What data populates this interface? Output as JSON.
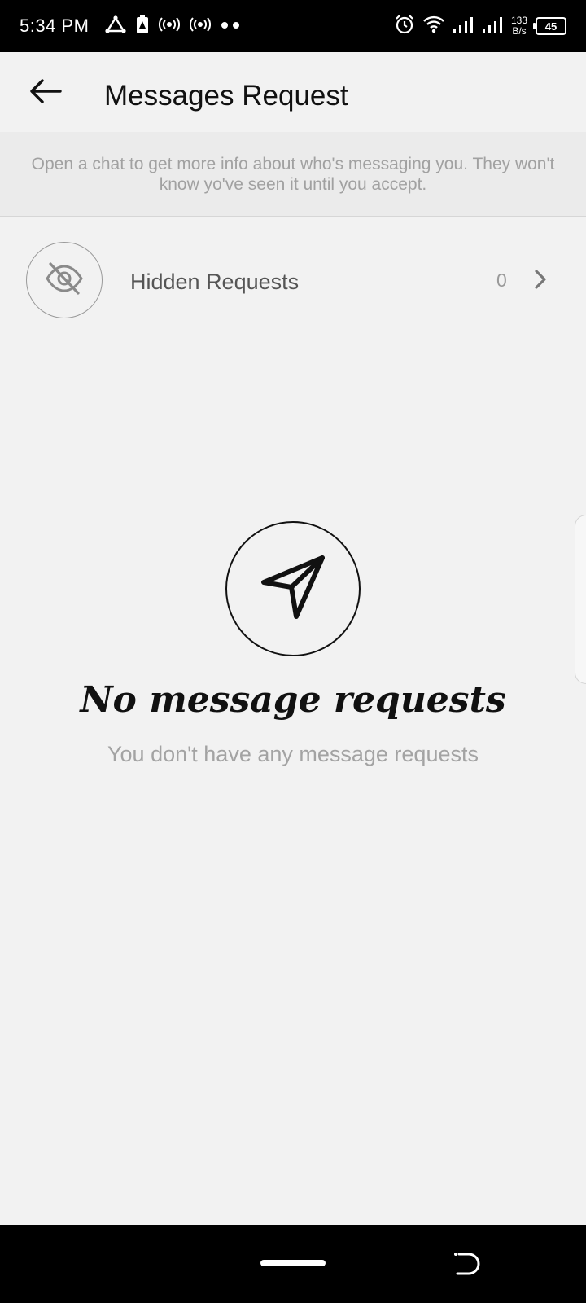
{
  "status_bar": {
    "time": "5:34 PM",
    "net_speed_value": "133",
    "net_speed_unit": "B/s",
    "battery": "45",
    "icons": [
      "triangle-network-icon",
      "battery-saver-icon",
      "hotspot-icon",
      "hotspot-icon",
      "more-dots-icon",
      "alarm-icon",
      "wifi-icon",
      "signal-icon",
      "signal-icon",
      "battery-icon"
    ]
  },
  "header": {
    "title": "Messages Request",
    "back_icon": "arrow-left-icon"
  },
  "banner": {
    "text": "Open a chat to get more info about who's messaging you. They won't know yo've seen it until you accept."
  },
  "hidden_requests": {
    "label": "Hidden Requests",
    "count": "0",
    "icon": "eye-off-icon",
    "chevron": "chevron-right-icon"
  },
  "empty_state": {
    "icon": "send-icon",
    "title": "No message requests",
    "subtitle": "You don't have any message requests"
  },
  "nav_bar": {
    "home": "home-pill",
    "recents": "back-gesture-icon"
  }
}
